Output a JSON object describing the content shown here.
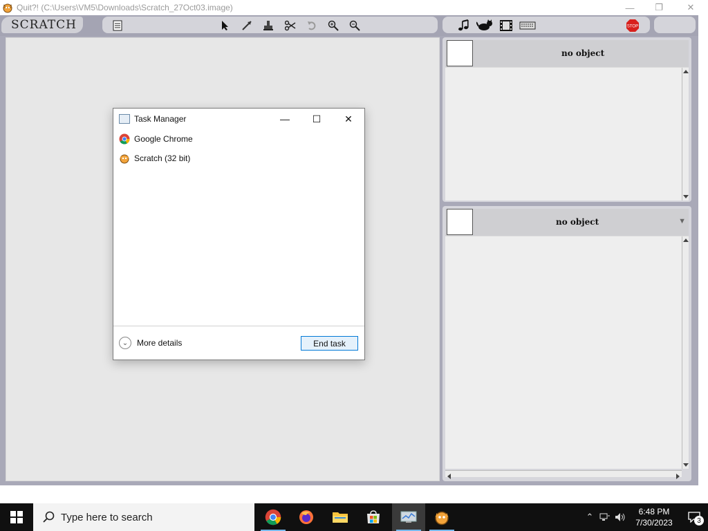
{
  "window": {
    "title": "Quit?! (C:\\Users\\VM5\\Downloads\\Scratch_27Oct03.image)",
    "minimize_glyph": "—",
    "restore_glyph": "❐",
    "close_glyph": "✕"
  },
  "scratch": {
    "logo": "SCRATCH",
    "toolbar_icons": [
      "notes-icon",
      "arrow-cursor-icon",
      "grow-icon",
      "stamp-icon",
      "scissors-icon",
      "undo-icon",
      "zoom-in-icon",
      "zoom-out-icon",
      "music-note-icon",
      "cat-icon",
      "film-icon",
      "keyboard-icon",
      "stop-icon"
    ],
    "stop_label": "STOP",
    "top_pane": {
      "name": "no object"
    },
    "bottom_pane": {
      "name": "no object",
      "dropdown_glyph": "▼"
    }
  },
  "task_manager": {
    "title": "Task Manager",
    "minimize_glyph": "—",
    "maximize_glyph": "☐",
    "close_glyph": "✕",
    "processes": [
      {
        "name": "Google Chrome",
        "icon": "chrome-icon"
      },
      {
        "name": "Scratch (32 bit)",
        "icon": "scratch-icon"
      }
    ],
    "more_details": "More details",
    "end_task": "End task"
  },
  "taskbar": {
    "search_placeholder": "Type here to search",
    "apps": [
      {
        "name": "chrome",
        "icon": "chrome-icon"
      },
      {
        "name": "firefox",
        "icon": "firefox-icon"
      },
      {
        "name": "file-explorer",
        "icon": "folder-icon"
      },
      {
        "name": "store",
        "icon": "store-icon"
      },
      {
        "name": "task-manager",
        "icon": "task-manager-icon"
      },
      {
        "name": "scratch",
        "icon": "scratch-icon"
      }
    ],
    "time": "6:48 PM",
    "date": "7/30/2023",
    "notification_count": "3"
  },
  "colors": {
    "accent": "#0078d7",
    "scratch_bg": "#a9a9b8",
    "stage_bg": "#e7e7e7",
    "taskbar_bg": "#101010"
  }
}
